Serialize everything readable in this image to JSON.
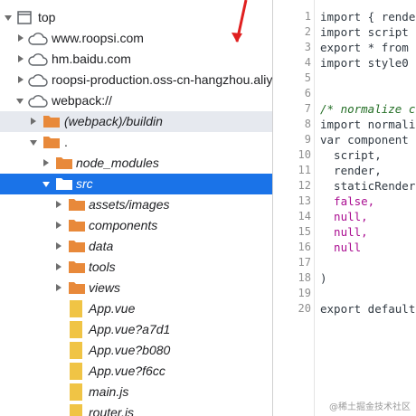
{
  "tree": {
    "items": [
      {
        "label": "top",
        "icon": "frame-icon",
        "expanded": true
      },
      {
        "label": "www.roopsi.com",
        "icon": "cloud-icon",
        "expanded": false
      },
      {
        "label": "hm.baidu.com",
        "icon": "cloud-icon",
        "expanded": false
      },
      {
        "label": "roopsi-production.oss-cn-hangzhou.aliy",
        "icon": "cloud-icon",
        "expanded": false
      },
      {
        "label": "webpack://",
        "icon": "cloud-icon",
        "expanded": true
      },
      {
        "label": "(webpack)/buildin",
        "icon": "folder-icon",
        "expanded": false
      },
      {
        "label": ".",
        "icon": "folder-icon",
        "expanded": true
      },
      {
        "label": "node_modules",
        "icon": "folder-icon",
        "expanded": false
      },
      {
        "label": "src",
        "icon": "folder-icon",
        "expanded": true
      },
      {
        "label": "assets/images",
        "icon": "folder-icon",
        "expanded": false
      },
      {
        "label": "components",
        "icon": "folder-icon",
        "expanded": false
      },
      {
        "label": "data",
        "icon": "folder-icon",
        "expanded": false
      },
      {
        "label": "tools",
        "icon": "folder-icon",
        "expanded": false
      },
      {
        "label": "views",
        "icon": "folder-icon",
        "expanded": false
      },
      {
        "label": "App.vue",
        "icon": "file-icon"
      },
      {
        "label": "App.vue?a7d1",
        "icon": "file-icon"
      },
      {
        "label": "App.vue?b080",
        "icon": "file-icon"
      },
      {
        "label": "App.vue?f6cc",
        "icon": "file-icon"
      },
      {
        "label": "main.js",
        "icon": "file-icon"
      },
      {
        "label": "router.js",
        "icon": "file-icon"
      }
    ]
  },
  "code": {
    "line_numbers": [
      "1",
      "2",
      "3",
      "4",
      "5",
      "6",
      "7",
      "8",
      "9",
      "10",
      "11",
      "12",
      "13",
      "14",
      "15",
      "16",
      "17",
      "18",
      "19",
      "20"
    ],
    "lines": [
      "import { rende",
      "import script",
      "export * from",
      "import style0",
      "",
      "",
      "/* normalize c",
      "import normali",
      "var component",
      "  script,",
      "  render,",
      "  staticRender",
      "  false,",
      "  null,",
      "  null,",
      "  null",
      "",
      ")",
      "",
      "export default"
    ]
  },
  "watermark": "@稀土掘金技术社区",
  "colors": {
    "selection": "#1a73e8",
    "hover": "#e6e9ef",
    "folder": "#e8893a",
    "file": "#f0c445",
    "keyword": "#aa0d91",
    "comment": "#236e25",
    "arrow": "#e02020"
  }
}
